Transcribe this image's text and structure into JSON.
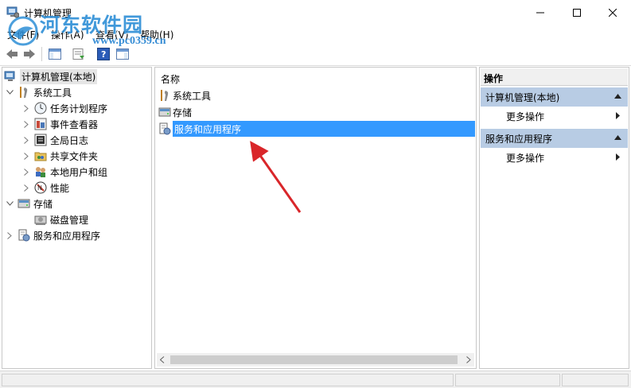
{
  "window": {
    "title": "计算机管理"
  },
  "watermark": {
    "main": "河东软件园",
    "url": "www.pc0359.cn"
  },
  "menu": {
    "items": [
      "文件(F)",
      "操作(A)",
      "查看(V)",
      "帮助(H)"
    ]
  },
  "tree": {
    "root": "计算机管理(本地)",
    "system_tools": "系统工具",
    "children": [
      "任务计划程序",
      "事件查看器",
      "全局日志",
      "共享文件夹",
      "本地用户和组",
      "性能"
    ],
    "storage": "存储",
    "disk_mgmt": "磁盘管理",
    "services": "服务和应用程序"
  },
  "center": {
    "column_header": "名称",
    "rows": [
      "系统工具",
      "存储",
      "服务和应用程序"
    ],
    "selected_index": 2
  },
  "actions": {
    "header": "操作",
    "sections": [
      {
        "title": "计算机管理(本地)",
        "item": "更多操作"
      },
      {
        "title": "服务和应用程序",
        "item": "更多操作"
      }
    ]
  },
  "colors": {
    "selection": "#3399ff",
    "section_bg": "#b8cce4",
    "arrow": "#d9262a"
  }
}
